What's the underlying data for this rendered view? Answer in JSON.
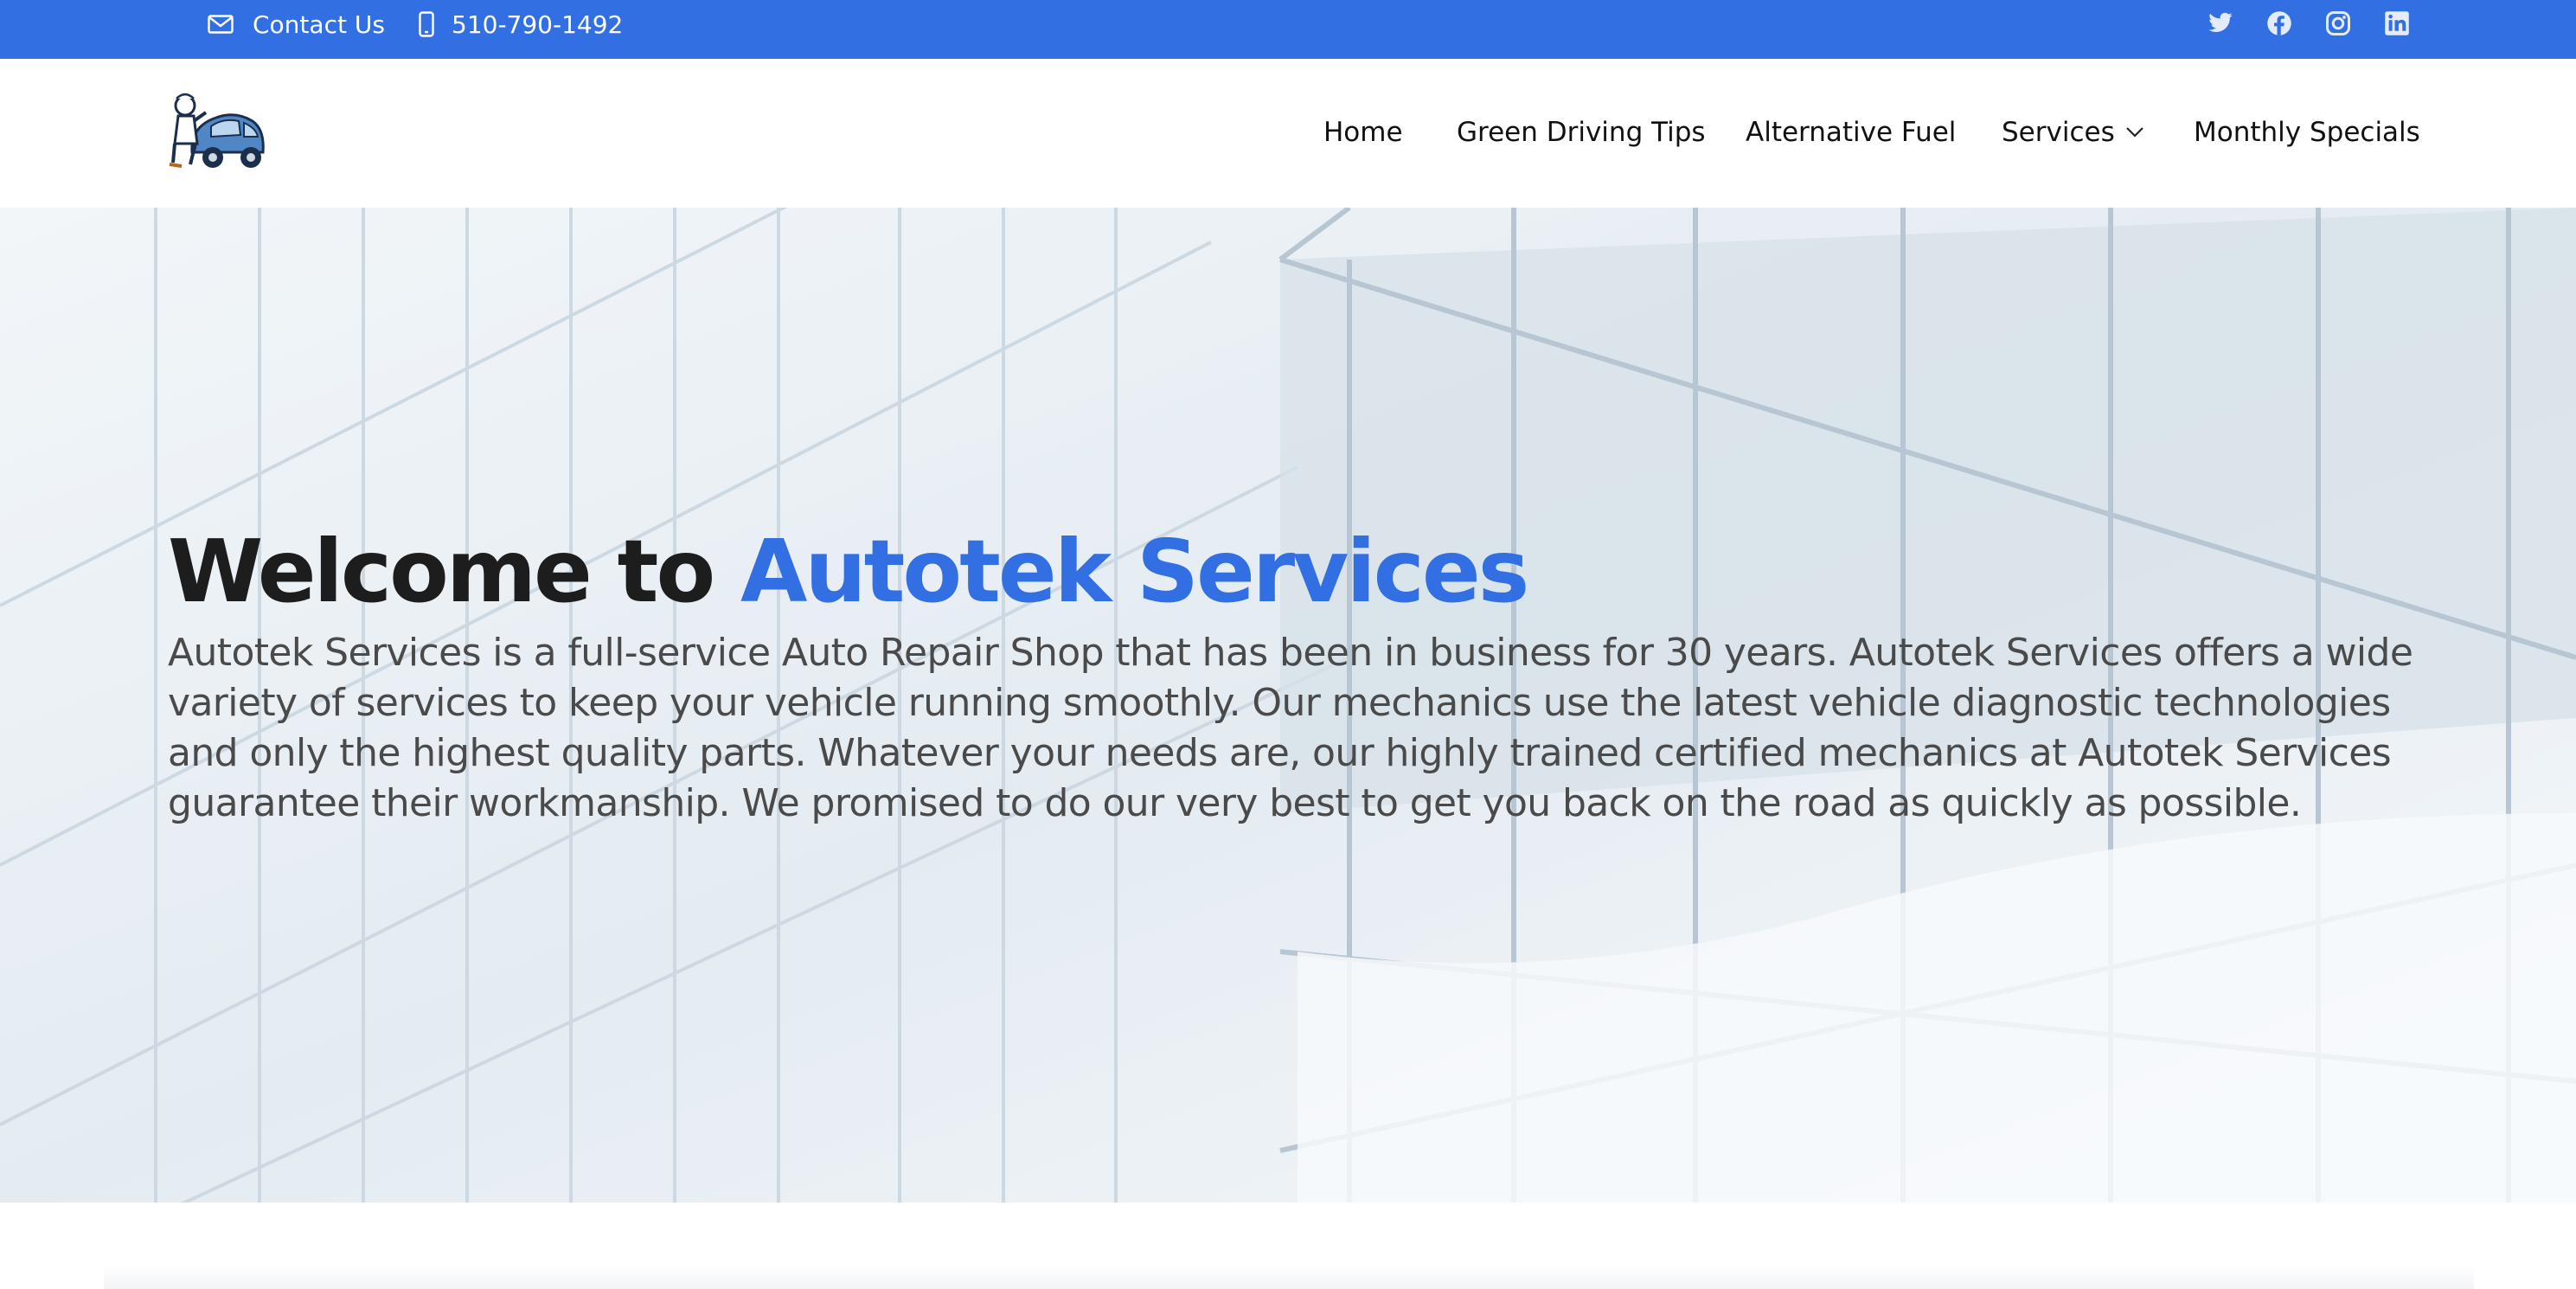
{
  "topbar": {
    "contact_label": "Contact Us",
    "phone_label": "510-790-1492",
    "social": [
      "twitter-icon",
      "facebook-icon",
      "instagram-icon",
      "linkedin-icon"
    ]
  },
  "header": {
    "logo": "Autotek Services mechanic car logo",
    "nav": {
      "home": "Home",
      "green": "Green Driving Tips",
      "alt": "Alternative Fuel",
      "services": "Services",
      "monthly": "Monthly Specials"
    }
  },
  "hero": {
    "title_prefix": "Welcome to",
    "title_accent": "Autotek Services",
    "description": "Autotek Services is a full-service Auto Repair Shop that has been in business for 30 years. Autotek Services offers a wide variety of services to keep your vehicle running smoothly. Our mechanics use the latest vehicle diagnostic technologies and only the highest quality parts. Whatever your needs are, our highly trained certified mechanics at Autotek Services guarantee their workmanship. We promised to do our very best to get you back on the road as quickly as possible."
  },
  "colors": {
    "accent": "#326fe3",
    "topbar": "#326fe3",
    "heading": "#1d1d1d",
    "body_text": "#4a4a4a"
  }
}
